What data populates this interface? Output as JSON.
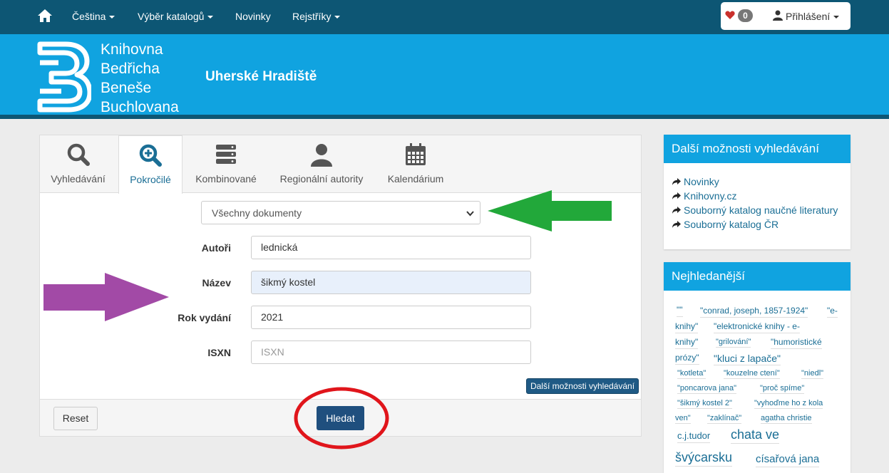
{
  "nav": {
    "items": [
      "Čeština",
      "Výběr katalogů",
      "Novinky",
      "Rejstříky"
    ],
    "favorites_count": "0",
    "login_label": "Přihlášení"
  },
  "header": {
    "library_lines": [
      "Knihovna",
      "Bedřicha",
      "Beneše",
      "Buchlovana"
    ],
    "city": "Uherské Hradiště"
  },
  "tabs": [
    {
      "label": "Vyhledávání",
      "icon": "search-icon"
    },
    {
      "label": "Pokročilé",
      "icon": "zoom-plus-icon",
      "active": true
    },
    {
      "label": "Kombinované",
      "icon": "server-icon"
    },
    {
      "label": "Regionální autority",
      "icon": "person-icon"
    },
    {
      "label": "Kalendárium",
      "icon": "calendar-icon"
    }
  ],
  "form": {
    "doc_type_selected": "Všechny dokumenty",
    "fields": [
      {
        "label": "Autoři",
        "value": "lednická",
        "placeholder": ""
      },
      {
        "label": "Název",
        "value": "šikmý kostel",
        "placeholder": ""
      },
      {
        "label": "Rok vydání",
        "value": "2021",
        "placeholder": ""
      },
      {
        "label": "ISXN",
        "value": "",
        "placeholder": "ISXN"
      }
    ],
    "more_options_button": "Další možnosti vyhledávání",
    "reset_label": "Reset",
    "search_label": "Hledat"
  },
  "sidebar": {
    "more_title": "Další možnosti vyhledávání",
    "links": [
      "Novinky",
      "Knihovny.cz",
      "Souborný katalog naučné literatury",
      "Souborný katalog ČR"
    ],
    "popular_title": "Nejhledanější",
    "tags": [
      "\"\"",
      "\"conrad, joseph, 1857-1924\"",
      "\"e-",
      "knihy\"",
      "\"elektronické knihy - e-",
      "knihy\"",
      "\"grilování\"",
      "\"humoristické",
      "prózy\"",
      "\"kluci z lapače\"",
      "\"kotleta\"",
      "\"kouzelne ctení\"",
      "\"niedl\"",
      "\"poncarova jana\"",
      "\"proč spíme\"",
      "\"šikmý kostel 2\"",
      "\"vyhoďme ho z kola",
      "ven\"",
      "\"zaklínač\"",
      "agatha christie",
      "c.j.tudor",
      "chata ve",
      "švýcarsku",
      "císařová jana"
    ]
  },
  "colors": {
    "navbar": "#0d5674",
    "banner": "#10a3e0",
    "primary_button": "#1f4f7e",
    "link": "#1a6e95",
    "annotation_green": "#22a83a",
    "annotation_purple": "#a24aa6",
    "annotation_red": "#e0151b"
  }
}
